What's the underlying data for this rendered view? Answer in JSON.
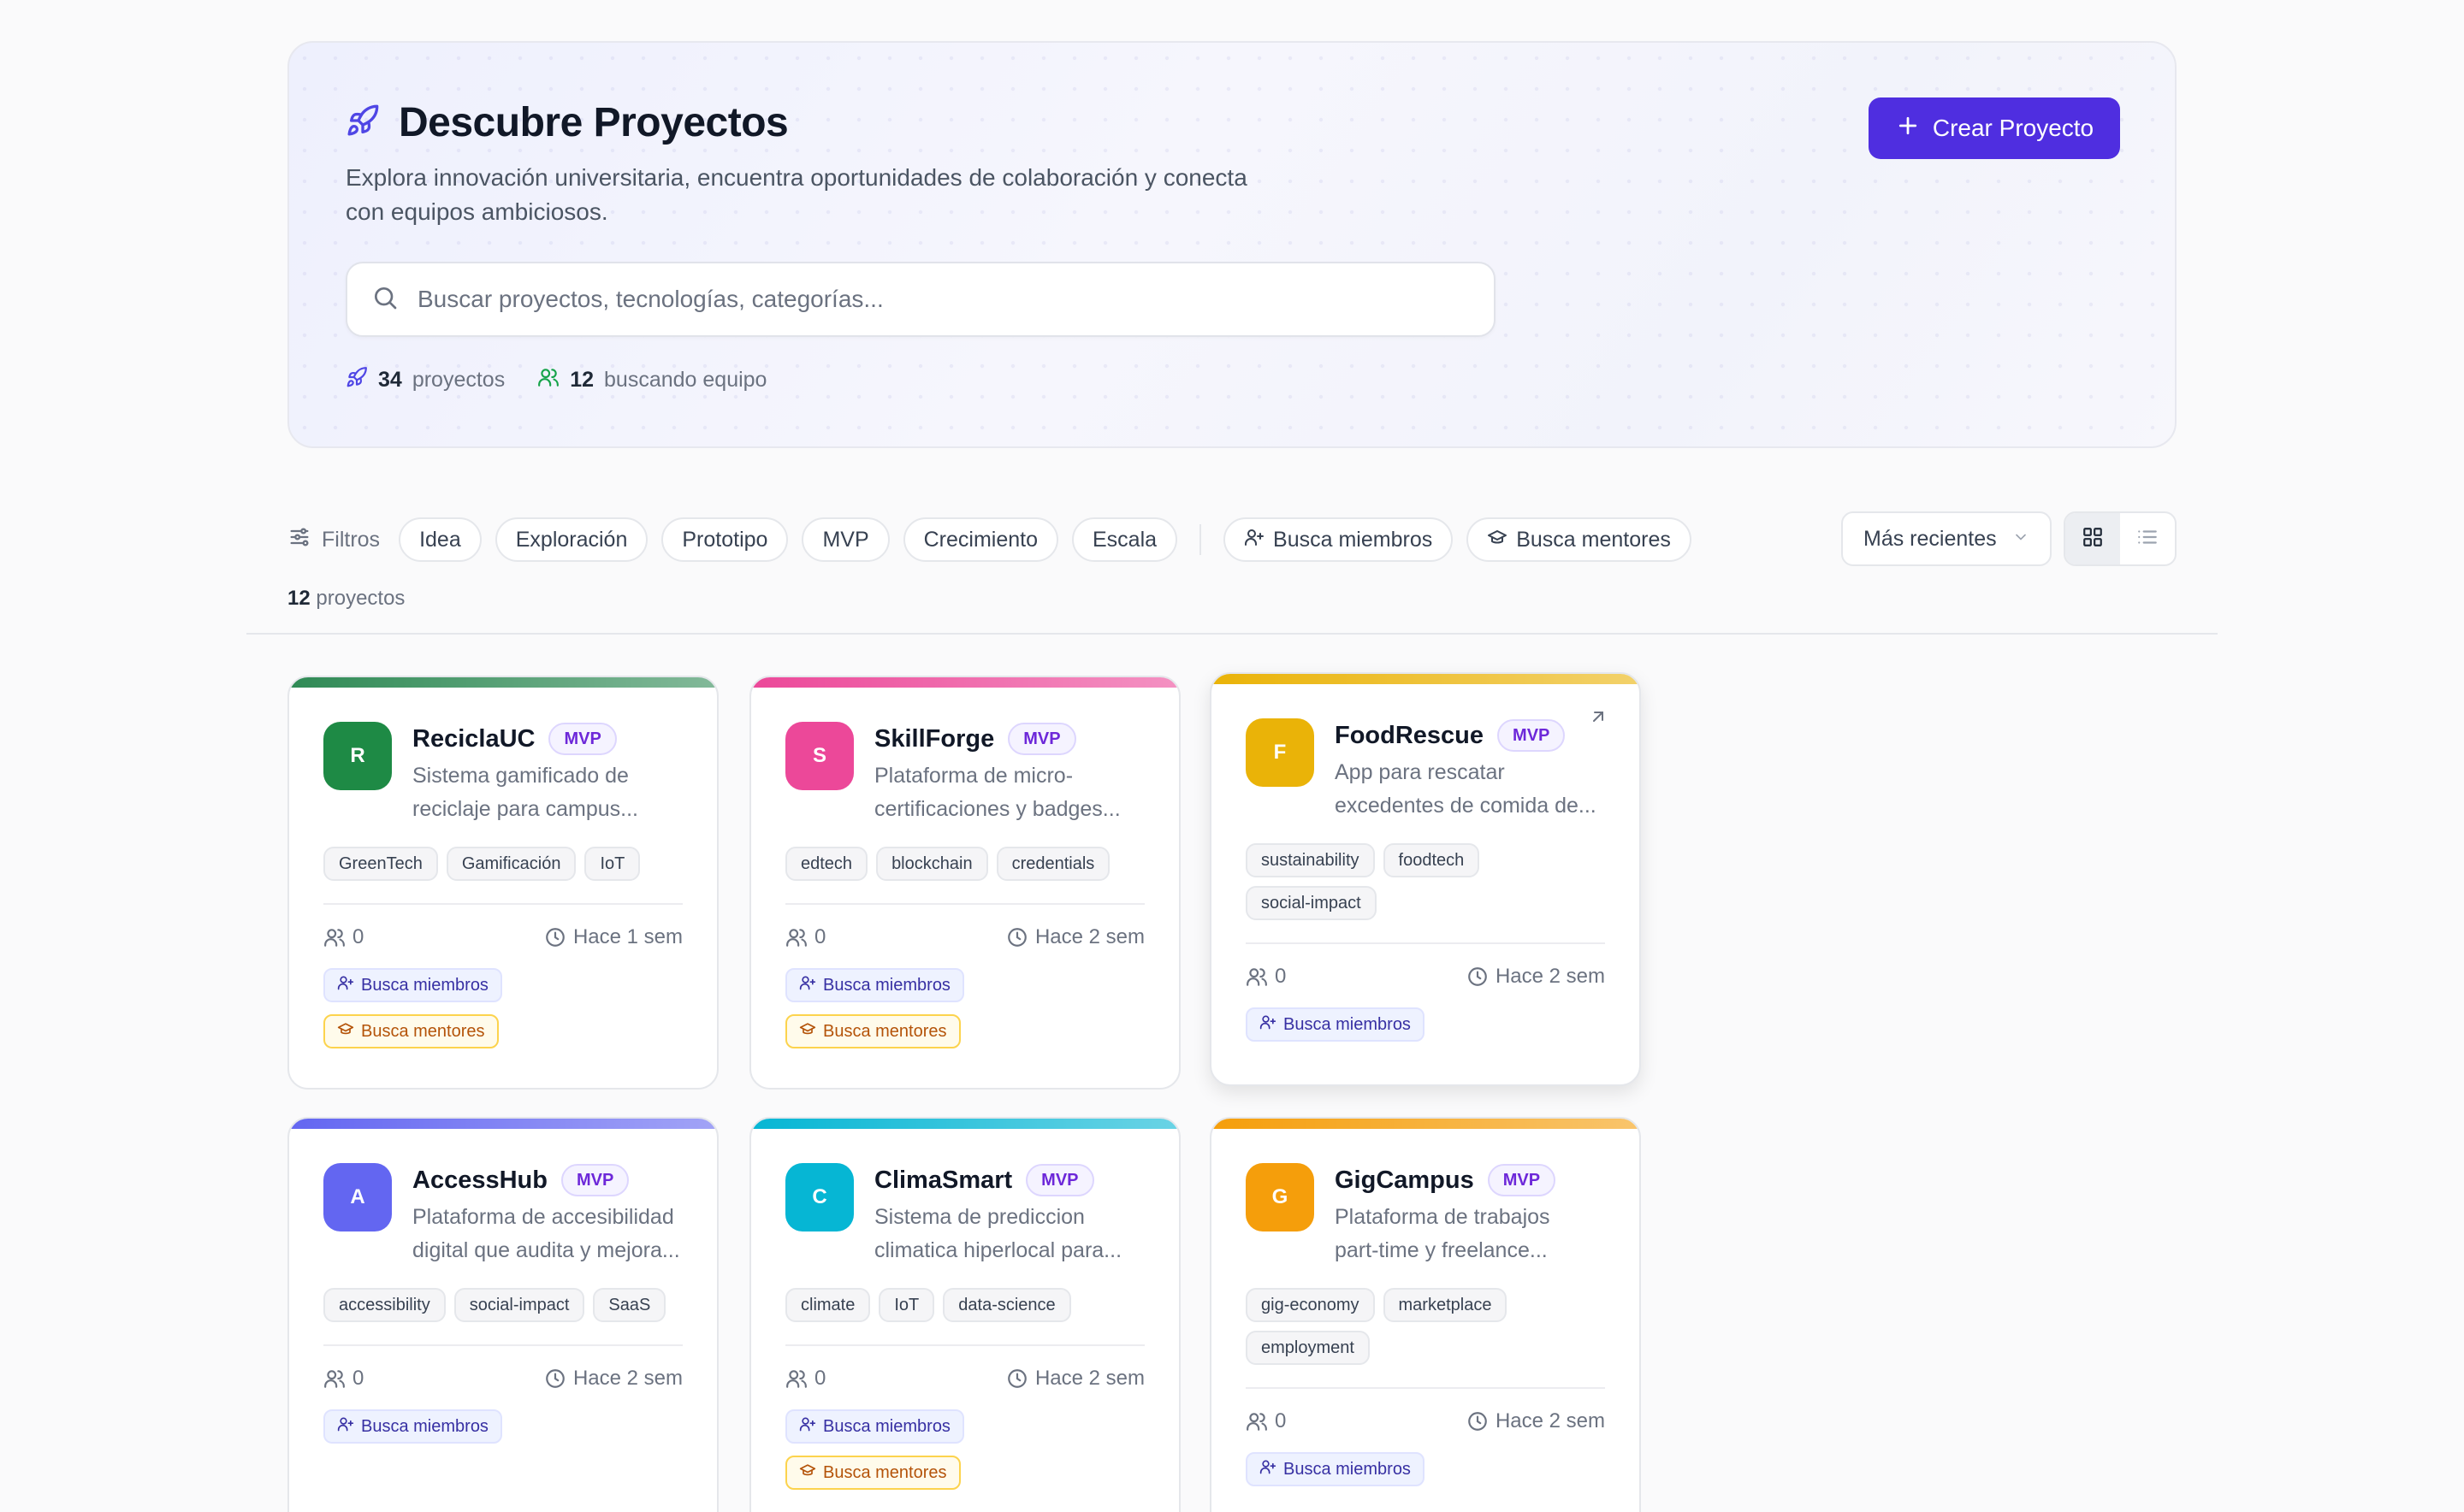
{
  "hero": {
    "title": "Descubre Proyectos",
    "subtitle": "Explora innovación universitaria, encuentra oportunidades de colaboración y conecta con equipos ambiciosos.",
    "create_label": "Crear Proyecto",
    "search_placeholder": "Buscar proyectos, tecnologías, categorías...",
    "stat_projects_value": "34",
    "stat_projects_label": "proyectos",
    "stat_team_value": "12",
    "stat_team_label": "buscando equipo"
  },
  "filters": {
    "label": "Filtros",
    "stages": [
      "Idea",
      "Exploración",
      "Prototipo",
      "MVP",
      "Crecimiento",
      "Escala"
    ],
    "seek_members": "Busca miembros",
    "seek_mentors": "Busca mentores",
    "sort_value": "Más recientes"
  },
  "results": {
    "count": "12",
    "label": "proyectos"
  },
  "cards": [
    {
      "initial": "R",
      "name": "ReciclaUC",
      "stage": "MVP",
      "desc_line1": "Sistema gamificado de",
      "desc_line2": "reciclaje para campus...",
      "tags": [
        "GreenTech",
        "Gamificación",
        "IoT"
      ],
      "members": "0",
      "time": "Hace 1 sem",
      "flag_members": "Busca miembros",
      "flag_mentors": "Busca mentores",
      "color": "#1e8a45",
      "bar": "#2f8a55"
    },
    {
      "initial": "S",
      "name": "SkillForge",
      "stage": "MVP",
      "desc_line1": "Plataforma de micro-",
      "desc_line2": "certificaciones y badges...",
      "tags": [
        "edtech",
        "blockchain",
        "credentials"
      ],
      "members": "0",
      "time": "Hace 2 sem",
      "flag_members": "Busca miembros",
      "flag_mentors": "Busca mentores",
      "color": "#ec4899",
      "bar": "#ec4899"
    },
    {
      "initial": "F",
      "name": "FoodRescue",
      "stage": "MVP",
      "desc_line1": "App para rescatar",
      "desc_line2": "excedentes de comida de...",
      "tags": [
        "sustainability",
        "foodtech",
        "social-impact"
      ],
      "members": "0",
      "time": "Hace 2 sem",
      "flag_members": "Busca miembros",
      "color": "#eab308",
      "bar": "#eab308"
    },
    {
      "initial": "A",
      "name": "AccessHub",
      "stage": "MVP",
      "desc_line1": "Plataforma de accesibilidad",
      "desc_line2": "digital que audita y mejora...",
      "tags": [
        "accessibility",
        "social-impact",
        "SaaS"
      ],
      "members": "0",
      "time": "Hace 2 sem",
      "flag_members": "Busca miembros",
      "color": "#6366f1",
      "bar": "#6366f1"
    },
    {
      "initial": "C",
      "name": "ClimaSmart",
      "stage": "MVP",
      "desc_line1": "Sistema de prediccion",
      "desc_line2": "climatica hiperlocal para...",
      "tags": [
        "climate",
        "IoT",
        "data-science"
      ],
      "members": "0",
      "time": "Hace 2 sem",
      "flag_members": "Busca miembros",
      "flag_mentors": "Busca mentores",
      "color": "#06b6d4",
      "bar": "#06b6d4"
    },
    {
      "initial": "G",
      "name": "GigCampus",
      "stage": "MVP",
      "desc_line1": "Plataforma de trabajos",
      "desc_line2": "part-time y freelance...",
      "tags": [
        "gig-economy",
        "marketplace",
        "employment"
      ],
      "members": "0",
      "time": "Hace 2 sem",
      "flag_members": "Busca miembros",
      "color": "#f59e0b",
      "bar": "#f59e0b"
    }
  ]
}
